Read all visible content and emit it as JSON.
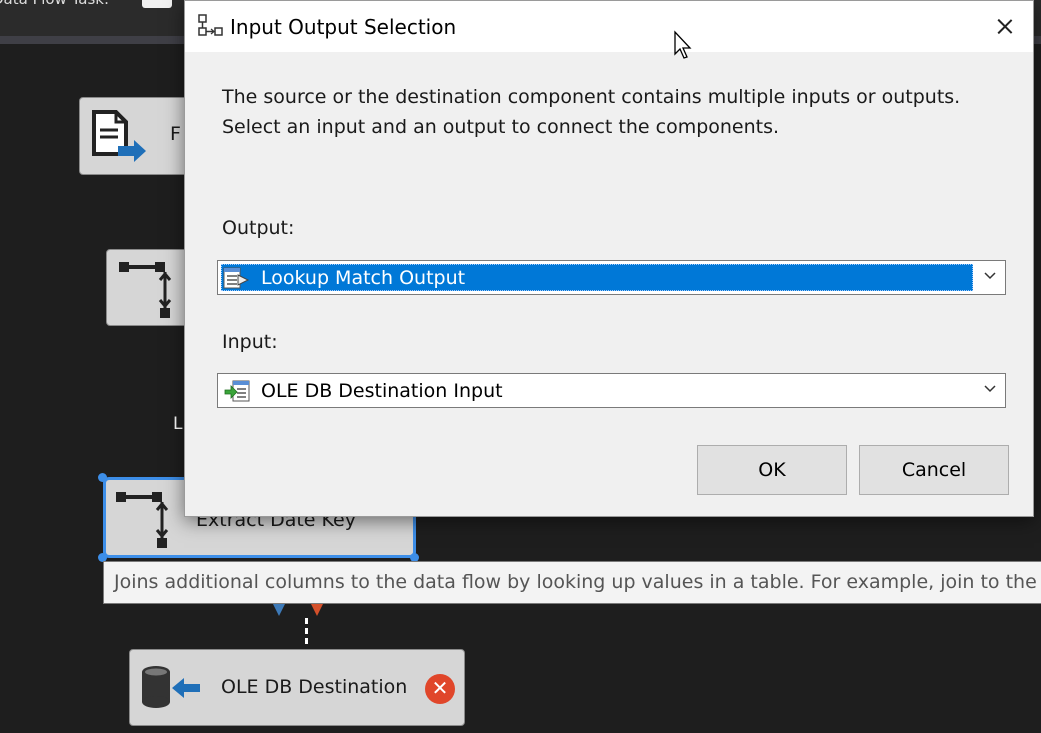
{
  "designer": {
    "tab_title": "Data Flow Task:",
    "flat_file_label": "F",
    "left_label": "L",
    "extract_label": "Extract Date Key",
    "ole_destination_label": "OLE DB Destination",
    "error_badge": "✕",
    "tooltip": "Joins additional columns to the data flow by looking up values in a table. For example, join to the ..."
  },
  "dialog": {
    "title": "Input Output Selection",
    "description": "The source or the destination component contains multiple inputs or outputs. Select an input and an output to connect the components.",
    "output_label": "Output:",
    "output_value": "Lookup Match Output",
    "input_label": "Input:",
    "input_value": "OLE DB Destination Input",
    "ok_label": "OK",
    "cancel_label": "Cancel"
  },
  "colors": {
    "selection": "#0078d7",
    "dialog_bg": "#f0f0f0",
    "canvas_bg": "#1e1e1e",
    "error": "#e0462a"
  },
  "icons": [
    "flat-file-source-icon",
    "derived-column-icon",
    "ole-db-destination-icon",
    "error-icon",
    "dialog-app-icon",
    "close-icon",
    "output-icon",
    "input-icon",
    "chevron-down-icon",
    "mouse-cursor-icon"
  ]
}
